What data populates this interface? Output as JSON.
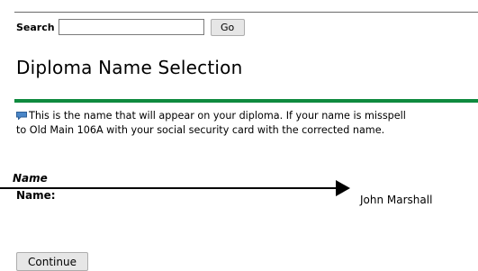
{
  "search": {
    "label": "Search",
    "value": "",
    "go_label": "Go"
  },
  "page_title": "Diploma Name Selection",
  "info": {
    "icon": "info-speech-bubble-icon",
    "line1": "This is the name that will appear on your diploma. If your name is misspell",
    "line2": "to Old Main 106A with your social security card with the corrected name."
  },
  "section": {
    "heading": "Name",
    "field_label": "Name:",
    "field_value": "John Marshall"
  },
  "continue_label": "Continue",
  "colors": {
    "accent_bar": "#0f8a3f",
    "info_icon": "#4a86c8"
  }
}
